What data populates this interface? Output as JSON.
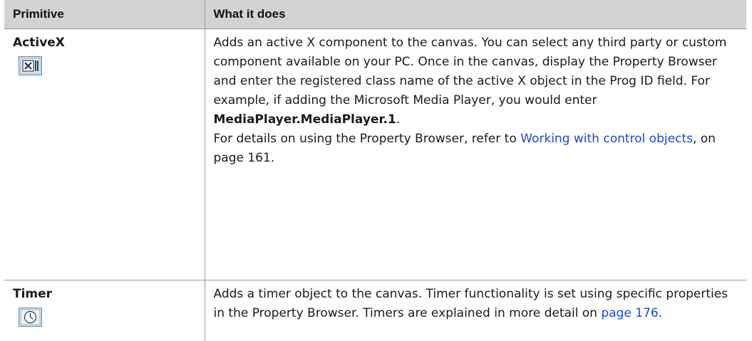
{
  "table": {
    "headers": {
      "primitive": "Primitive",
      "what_it_does": "What it does"
    },
    "rows": {
      "activex": {
        "name": "ActiveX",
        "icon": "activex-icon",
        "desc_1": "Adds an active X component to the canvas. You can select any third party or custom component available on your PC. Once in the canvas, display the Property Browser and enter the registered class name of the active X object in the Prog ID field. For example, if adding the Microsoft Media Player, you would enter ",
        "desc_bold": "MediaPlayer.MediaPlayer.1",
        "desc_end": ".",
        "desc_2_before": "For details on using the Property Browser, refer to ",
        "desc_2_link": "Working with control objects",
        "desc_2_after": ", on page 161."
      },
      "timer": {
        "name": "Timer",
        "icon": "timer-icon",
        "desc_before": "Adds a timer object to the canvas. Timer functionality is set using specific properties in the Property Browser. Timers are explained in more detail on ",
        "desc_link": "page 176",
        "desc_after": "."
      }
    }
  },
  "colors": {
    "header_bg": "#d3d3d3",
    "link": "#1a49d6",
    "rule": "#9a9a9a"
  }
}
